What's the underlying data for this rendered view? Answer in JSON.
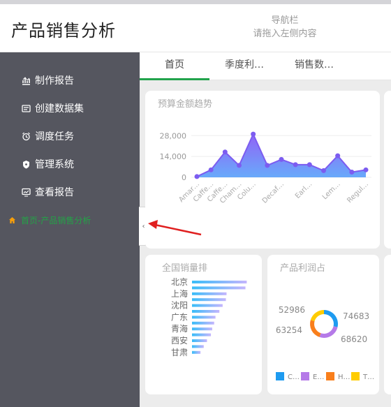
{
  "app": {
    "title": "产品销售分析"
  },
  "nav_hint": {
    "line1": "导航栏",
    "line2": "请拖入左侧内容"
  },
  "sidebar": {
    "items": [
      {
        "label": "制作报告",
        "icon": "chart-icon"
      },
      {
        "label": "创建数据集",
        "icon": "dataset-icon"
      },
      {
        "label": "调度任务",
        "icon": "alarm-clock-icon"
      },
      {
        "label": "管理系统",
        "icon": "shield-icon"
      },
      {
        "label": "查看报告",
        "icon": "monitor-chart-icon"
      }
    ],
    "active_item": {
      "label": "首页-产品销售分析",
      "icon": "home-icon"
    }
  },
  "collapse_glyph": "‹",
  "tabs": [
    {
      "label": "首页",
      "active": true
    },
    {
      "label": "季度利…",
      "active": false
    },
    {
      "label": "销售数…",
      "active": false
    }
  ],
  "cards": {
    "trend": {
      "title": "预算金额趋势"
    },
    "ranking": {
      "title": "全国销量排"
    },
    "profit": {
      "title": "产品利润占"
    }
  },
  "colors": {
    "accent_green": "#22a34c",
    "sidebar_bg": "#55565f",
    "area_top": "#8b5cf6",
    "area_bottom": "#60a5fa",
    "bar_top": "#c4b5fd",
    "bar_bottom": "#38bdf8",
    "arrow_red": "#e02020"
  },
  "chart_data": [
    {
      "type": "area",
      "title": "预算金额趋势",
      "categories": [
        "Amar…",
        "Caffe…",
        "Caffe…",
        "Cham…",
        "Colu…",
        "",
        "Decaf…",
        "",
        "Earl…",
        "",
        "Lem…",
        "",
        "Regul…"
      ],
      "values": [
        500,
        5000,
        17000,
        8000,
        29000,
        8000,
        12000,
        8500,
        8500,
        4500,
        14500,
        3500,
        5000
      ],
      "y_ticks": [
        "28,000",
        "14,000",
        "0"
      ],
      "ylim": [
        0,
        30000
      ],
      "grid": true
    },
    {
      "type": "bar",
      "title": "全国销量排",
      "orientation": "horizontal",
      "categories": [
        "北京",
        "",
        "上海",
        "",
        "沈阳",
        "",
        "广东",
        "",
        "青海",
        "",
        "西安",
        "",
        "甘肃"
      ],
      "values": [
        84,
        82,
        53,
        52,
        47,
        42,
        36,
        34,
        31,
        29,
        23,
        18,
        13
      ],
      "xlim": [
        0,
        90
      ]
    },
    {
      "type": "pie",
      "title": "产品利润占",
      "donut": true,
      "slices": [
        {
          "name": "C…",
          "value": 74683,
          "color": "#1e9bf0"
        },
        {
          "name": "E…",
          "value": 68620,
          "color": "#b57ae8"
        },
        {
          "name": "H…",
          "value": 63254,
          "color": "#f97f1c"
        },
        {
          "name": "T…",
          "value": 52986,
          "color": "#ffcc00"
        }
      ]
    }
  ]
}
